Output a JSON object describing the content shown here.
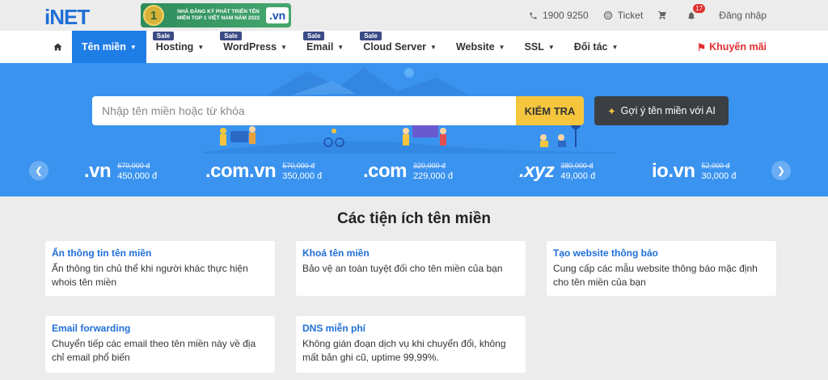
{
  "brand": {
    "logo": "iNET",
    "award_text": "NHÀ ĐĂNG KÝ PHÁT TRIỂN TÊN MIỀN TOP 1 VIỆT NAM NĂM 2023",
    "award_number": "1",
    "award_vn": ".vn"
  },
  "topbar": {
    "phone": "1900 9250",
    "ticket": "Ticket",
    "notification_count": "17",
    "login": "Đăng nhập"
  },
  "nav": {
    "items": [
      {
        "label": "Tên miền",
        "sale": ""
      },
      {
        "label": "Hosting",
        "sale": "Sale"
      },
      {
        "label": "WordPress",
        "sale": "Sale"
      },
      {
        "label": "Email",
        "sale": "Sale"
      },
      {
        "label": "Cloud Server",
        "sale": "Sale"
      },
      {
        "label": "Website",
        "sale": ""
      },
      {
        "label": "SSL",
        "sale": ""
      },
      {
        "label": "Đối tác",
        "sale": ""
      }
    ],
    "promo": "Khuyến mãi"
  },
  "hero": {
    "search_placeholder": "Nhập tên miền hoặc từ khóa",
    "check_button": "KIỂM TRA",
    "ai_button": "Gợi ý tên miền với AI",
    "tlds": [
      {
        "name": ".vn",
        "old": "670,000 đ",
        "new": "450,000 đ"
      },
      {
        "name": ".com.vn",
        "old": "570,000 đ",
        "new": "350,000 đ"
      },
      {
        "name": ".com",
        "old": "320,000 đ",
        "new": "229,000 đ"
      },
      {
        "name": ".xyz",
        "old": "380,000 đ",
        "new": "49,000 đ"
      },
      {
        "name": "io.vn",
        "old": "52,000 đ",
        "new": "30,000 đ"
      }
    ]
  },
  "section": {
    "title": "Các tiện ích tên miền",
    "cards": [
      {
        "title": "Ẩn thông tin tên miền",
        "desc": "Ẩn thông tin chủ thể khi người khác thực hiện whois tên miền"
      },
      {
        "title": "Khoá tên miền",
        "desc": "Bảo vệ an toàn tuyệt đối cho tên miền của bạn"
      },
      {
        "title": "Tạo website thông báo",
        "desc": "Cung cấp các mẫu website thông báo mặc định cho tên miền của bạn"
      },
      {
        "title": "Email forwarding",
        "desc": "Chuyển tiếp các email theo tên miền này về địa chỉ email phổ biến"
      },
      {
        "title": "DNS miễn phí",
        "desc": "Không gián đoạn dịch vụ khi chuyển đổi, không mất bản ghi cũ, uptime 99,99%."
      }
    ]
  },
  "colors": {
    "primary": "#1f7de6",
    "hero_bg": "#3a93ef",
    "accent_yellow": "#f5c63d",
    "promo_red": "#e0302f"
  }
}
